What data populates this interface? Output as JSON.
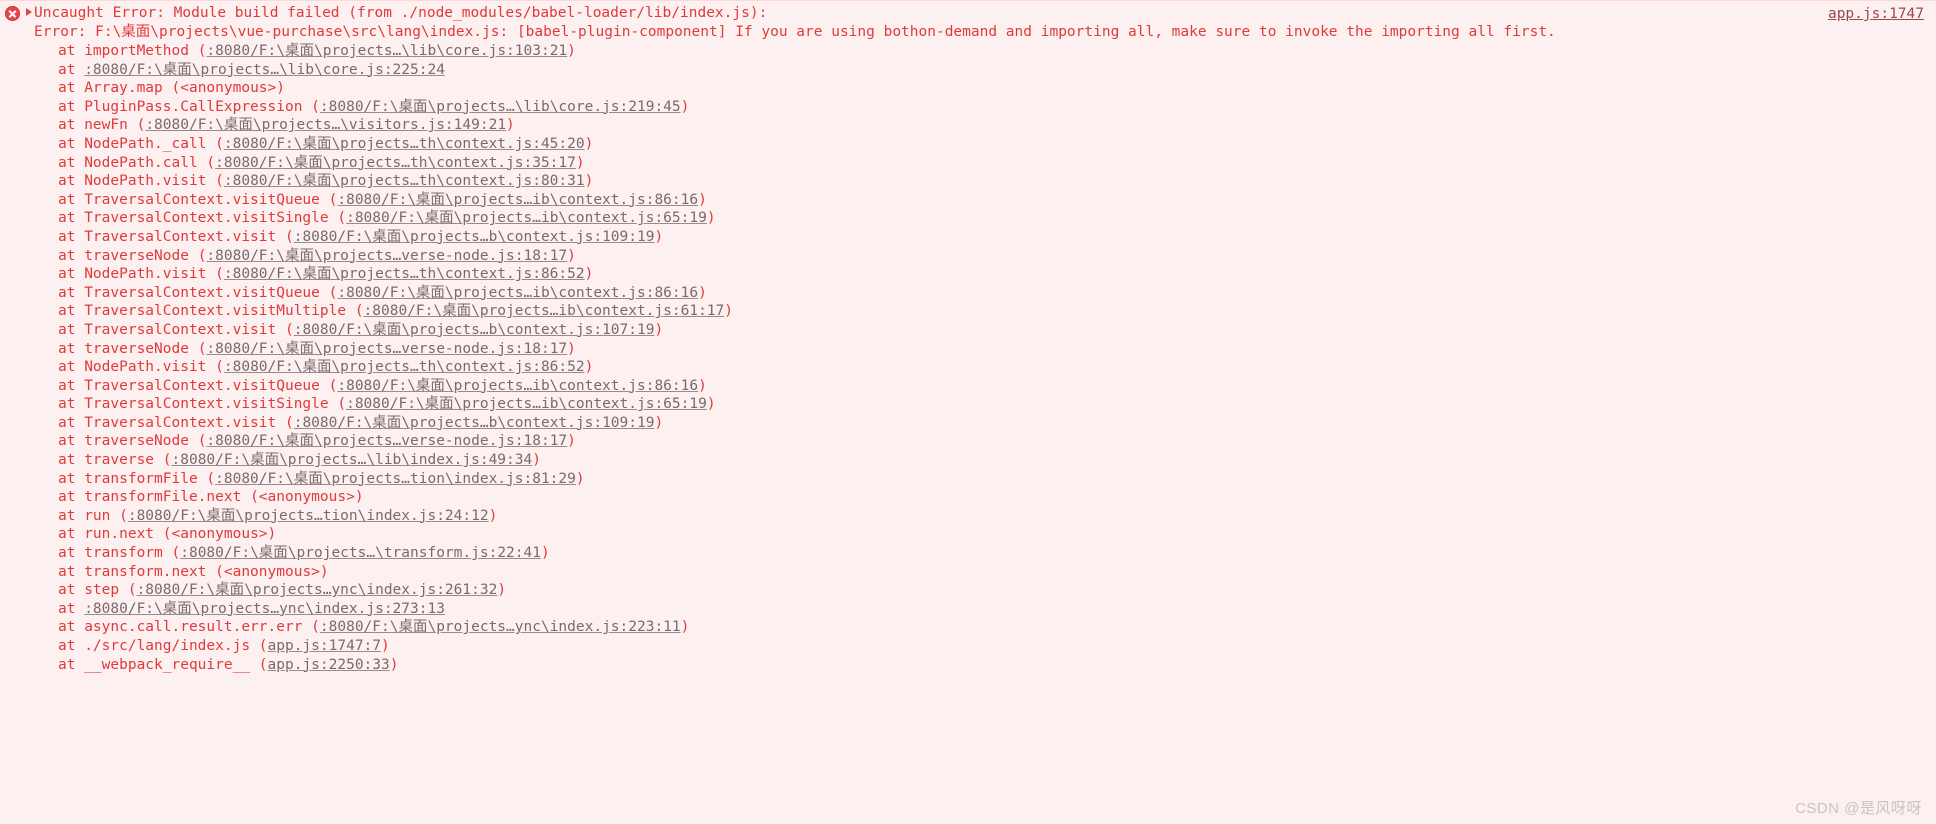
{
  "panel": {
    "type": "devtools-console-error",
    "background_color": "#fdf0f0",
    "text_color": "#e03a3a",
    "link_color": "#7a6a6a",
    "icon_color": "#e8454a"
  },
  "header": {
    "icon_name": "error-icon",
    "expand_triangle": "disclosure-triangle",
    "message_line1": "Uncaught Error: Module build failed (from ./node_modules/babel-loader/lib/index.js):",
    "message_line2": "Error: F:\\桌面\\projects\\vue-purchase\\src\\lang\\index.js: [babel-plugin-component] If you are using bothon-demand and importing all, make sure to invoke the importing all first.",
    "source_link": "app.js:1747"
  },
  "stack": [
    {
      "fn": "at importMethod ",
      "open": "(",
      "loc": ":8080/F:\\桌面\\projects…\\lib\\core.js:103:21",
      "close": ")"
    },
    {
      "fn": "at ",
      "open": "",
      "loc": ":8080/F:\\桌面\\projects…\\lib\\core.js:225:24",
      "close": ""
    },
    {
      "fn": "at Array.map ",
      "open": "",
      "loc": "",
      "close": "(<anonymous>)"
    },
    {
      "fn": "at PluginPass.CallExpression ",
      "open": "(",
      "loc": ":8080/F:\\桌面\\projects…\\lib\\core.js:219:45",
      "close": ")"
    },
    {
      "fn": "at newFn ",
      "open": "(",
      "loc": ":8080/F:\\桌面\\projects…\\visitors.js:149:21",
      "close": ")"
    },
    {
      "fn": "at NodePath._call ",
      "open": "(",
      "loc": ":8080/F:\\桌面\\projects…th\\context.js:45:20",
      "close": ")"
    },
    {
      "fn": "at NodePath.call ",
      "open": "(",
      "loc": ":8080/F:\\桌面\\projects…th\\context.js:35:17",
      "close": ")"
    },
    {
      "fn": "at NodePath.visit ",
      "open": "(",
      "loc": ":8080/F:\\桌面\\projects…th\\context.js:80:31",
      "close": ")"
    },
    {
      "fn": "at TraversalContext.visitQueue ",
      "open": "(",
      "loc": ":8080/F:\\桌面\\projects…ib\\context.js:86:16",
      "close": ")"
    },
    {
      "fn": "at TraversalContext.visitSingle ",
      "open": "(",
      "loc": ":8080/F:\\桌面\\projects…ib\\context.js:65:19",
      "close": ")"
    },
    {
      "fn": "at TraversalContext.visit ",
      "open": "(",
      "loc": ":8080/F:\\桌面\\projects…b\\context.js:109:19",
      "close": ")"
    },
    {
      "fn": "at traverseNode ",
      "open": "(",
      "loc": ":8080/F:\\桌面\\projects…verse-node.js:18:17",
      "close": ")"
    },
    {
      "fn": "at NodePath.visit ",
      "open": "(",
      "loc": ":8080/F:\\桌面\\projects…th\\context.js:86:52",
      "close": ")"
    },
    {
      "fn": "at TraversalContext.visitQueue ",
      "open": "(",
      "loc": ":8080/F:\\桌面\\projects…ib\\context.js:86:16",
      "close": ")"
    },
    {
      "fn": "at TraversalContext.visitMultiple ",
      "open": "(",
      "loc": ":8080/F:\\桌面\\projects…ib\\context.js:61:17",
      "close": ")"
    },
    {
      "fn": "at TraversalContext.visit ",
      "open": "(",
      "loc": ":8080/F:\\桌面\\projects…b\\context.js:107:19",
      "close": ")"
    },
    {
      "fn": "at traverseNode ",
      "open": "(",
      "loc": ":8080/F:\\桌面\\projects…verse-node.js:18:17",
      "close": ")"
    },
    {
      "fn": "at NodePath.visit ",
      "open": "(",
      "loc": ":8080/F:\\桌面\\projects…th\\context.js:86:52",
      "close": ")"
    },
    {
      "fn": "at TraversalContext.visitQueue ",
      "open": "(",
      "loc": ":8080/F:\\桌面\\projects…ib\\context.js:86:16",
      "close": ")"
    },
    {
      "fn": "at TraversalContext.visitSingle ",
      "open": "(",
      "loc": ":8080/F:\\桌面\\projects…ib\\context.js:65:19",
      "close": ")"
    },
    {
      "fn": "at TraversalContext.visit ",
      "open": "(",
      "loc": ":8080/F:\\桌面\\projects…b\\context.js:109:19",
      "close": ")"
    },
    {
      "fn": "at traverseNode ",
      "open": "(",
      "loc": ":8080/F:\\桌面\\projects…verse-node.js:18:17",
      "close": ")"
    },
    {
      "fn": "at traverse ",
      "open": "(",
      "loc": ":8080/F:\\桌面\\projects…\\lib\\index.js:49:34",
      "close": ")"
    },
    {
      "fn": "at transformFile ",
      "open": "(",
      "loc": ":8080/F:\\桌面\\projects…tion\\index.js:81:29",
      "close": ")"
    },
    {
      "fn": "at transformFile.next ",
      "open": "",
      "loc": "",
      "close": "(<anonymous>)"
    },
    {
      "fn": "at run ",
      "open": "(",
      "loc": ":8080/F:\\桌面\\projects…tion\\index.js:24:12",
      "close": ")"
    },
    {
      "fn": "at run.next ",
      "open": "",
      "loc": "",
      "close": "(<anonymous>)"
    },
    {
      "fn": "at transform ",
      "open": "(",
      "loc": ":8080/F:\\桌面\\projects…\\transform.js:22:41",
      "close": ")"
    },
    {
      "fn": "at transform.next ",
      "open": "",
      "loc": "",
      "close": "(<anonymous>)"
    },
    {
      "fn": "at step ",
      "open": "(",
      "loc": ":8080/F:\\桌面\\projects…ync\\index.js:261:32",
      "close": ")"
    },
    {
      "fn": "at ",
      "open": "",
      "loc": ":8080/F:\\桌面\\projects…ync\\index.js:273:13",
      "close": ""
    },
    {
      "fn": "at async.call.result.err.err ",
      "open": "(",
      "loc": ":8080/F:\\桌面\\projects…ync\\index.js:223:11",
      "close": ")"
    },
    {
      "fn": "at ./src/lang/index.js ",
      "open": "(",
      "loc": "app.js:1747:7",
      "close": ")"
    },
    {
      "fn": "at __webpack_require__ ",
      "open": "(",
      "loc": "app.js:2250:33",
      "close": ")"
    }
  ],
  "watermark": "CSDN @是风呀呀"
}
